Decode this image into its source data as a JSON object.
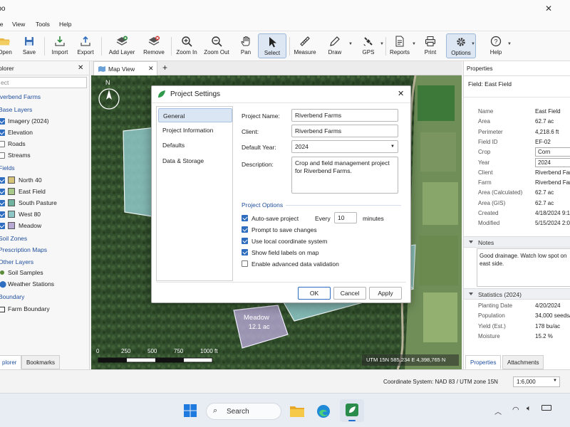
{
  "app": {
    "title": "mpo"
  },
  "menu": [
    "ile",
    "View",
    "Tools",
    "Help"
  ],
  "toolbar": {
    "open": "Open",
    "save": "Save",
    "import": "Import",
    "export": "Export",
    "add_layer": "Add Layer",
    "remove": "Remove",
    "zoom_in": "Zoom In",
    "zoom_out": "Zoom Out",
    "pan": "Pan",
    "select": "Select",
    "measure": "Measure",
    "draw": "Draw",
    "gps": "GPS",
    "reports": "Reports",
    "print": "Print",
    "options": "Options",
    "help": "Help"
  },
  "explorer": {
    "title": "plorer",
    "search_placeholder": "ect",
    "project": "iverbend Farms",
    "base_layers": "Base Layers",
    "base": [
      "Imagery (2024)",
      "Elevation",
      "Roads",
      "Streams"
    ],
    "fields_group": "Fields",
    "fields": [
      "North 40",
      "East Field",
      "South Pasture",
      "West 80",
      "Meadow"
    ],
    "soil": "Soil Zones",
    "prescription": "Prescription Maps",
    "other": "Other Layers",
    "other_items": [
      "Soil Samples",
      "Weather Stations"
    ],
    "boundary_group": "Boundary",
    "boundary_items": [
      "Farm Boundary"
    ],
    "tabs": [
      "plorer",
      "Bookmarks"
    ]
  },
  "map": {
    "tab": "Map View",
    "north": "N",
    "meadow_name": "Meadow",
    "meadow_area": "12.1 ac",
    "scale_labels": [
      "0",
      "250",
      "500",
      "750",
      "1000 ft"
    ],
    "coords": "UTM 15N   585,234 E   4,398,765 N"
  },
  "properties": {
    "title": "Properties",
    "field": "Field:  East Field",
    "rows": [
      {
        "k": "Name",
        "v": "East Field"
      },
      {
        "k": "Area",
        "v": "62.7 ac"
      },
      {
        "k": "Perimeter",
        "v": "4,218.6 ft"
      },
      {
        "k": "Field ID",
        "v": "EF-02"
      },
      {
        "k": "Crop",
        "v": "Corn"
      },
      {
        "k": "Year",
        "v": "2024"
      },
      {
        "k": "Client",
        "v": "Riverbend Far"
      },
      {
        "k": "Farm",
        "v": "Riverbend Far"
      },
      {
        "k": "Area (Calculated)",
        "v": "62.7 ac"
      },
      {
        "k": "Area (GIS)",
        "v": "62.7 ac"
      },
      {
        "k": "Created",
        "v": "4/18/2024 9:1"
      },
      {
        "k": "Modified",
        "v": "5/15/2024 2:0"
      }
    ],
    "notes_title": "Notes",
    "notes": "Good drainage. Watch low spot on east side.",
    "stats_title": "Statistics (2024)",
    "stats": [
      {
        "k": "Planting Date",
        "v": "4/20/2024"
      },
      {
        "k": "Population",
        "v": "34,000 seeds/"
      },
      {
        "k": "Yield (Est.)",
        "v": "178 bu/ac"
      },
      {
        "k": "Moisture",
        "v": "15.2 %"
      }
    ],
    "tabs": [
      "Properties",
      "Attachments"
    ]
  },
  "status": {
    "coord_system": "Coordinate System:  NAD 83 / UTM zone 15N",
    "scale": "1:6,000"
  },
  "taskbar": {
    "search": "Search"
  },
  "dialog": {
    "title": "Project Settings",
    "nav": [
      "General",
      "Project Information",
      "Defaults",
      "Data & Storage"
    ],
    "project_name_label": "Project Name:",
    "project_name": "Riverbend Farms",
    "client_label": "Client:",
    "client": "Riverbend Farms",
    "year_label": "Default Year:",
    "year": "2024",
    "description_label": "Description:",
    "description": "Crop and field management project for Riverbend Farms.",
    "options_title": "Project Options",
    "autosave": "Auto-save project",
    "every": "Every",
    "every_value": "10",
    "minutes": "minutes",
    "options": [
      {
        "label": "Prompt to save changes",
        "checked": true
      },
      {
        "label": "Use local coordinate system",
        "checked": true
      },
      {
        "label": "Show field labels on map",
        "checked": true
      },
      {
        "label": "Enable advanced data validation",
        "checked": false
      }
    ],
    "ok": "OK",
    "cancel": "Cancel",
    "apply": "Apply"
  },
  "colors": {
    "accent": "#2e6dc0",
    "selected_nav": "#dbe6f4",
    "field_fill": "#8fc7c7"
  }
}
